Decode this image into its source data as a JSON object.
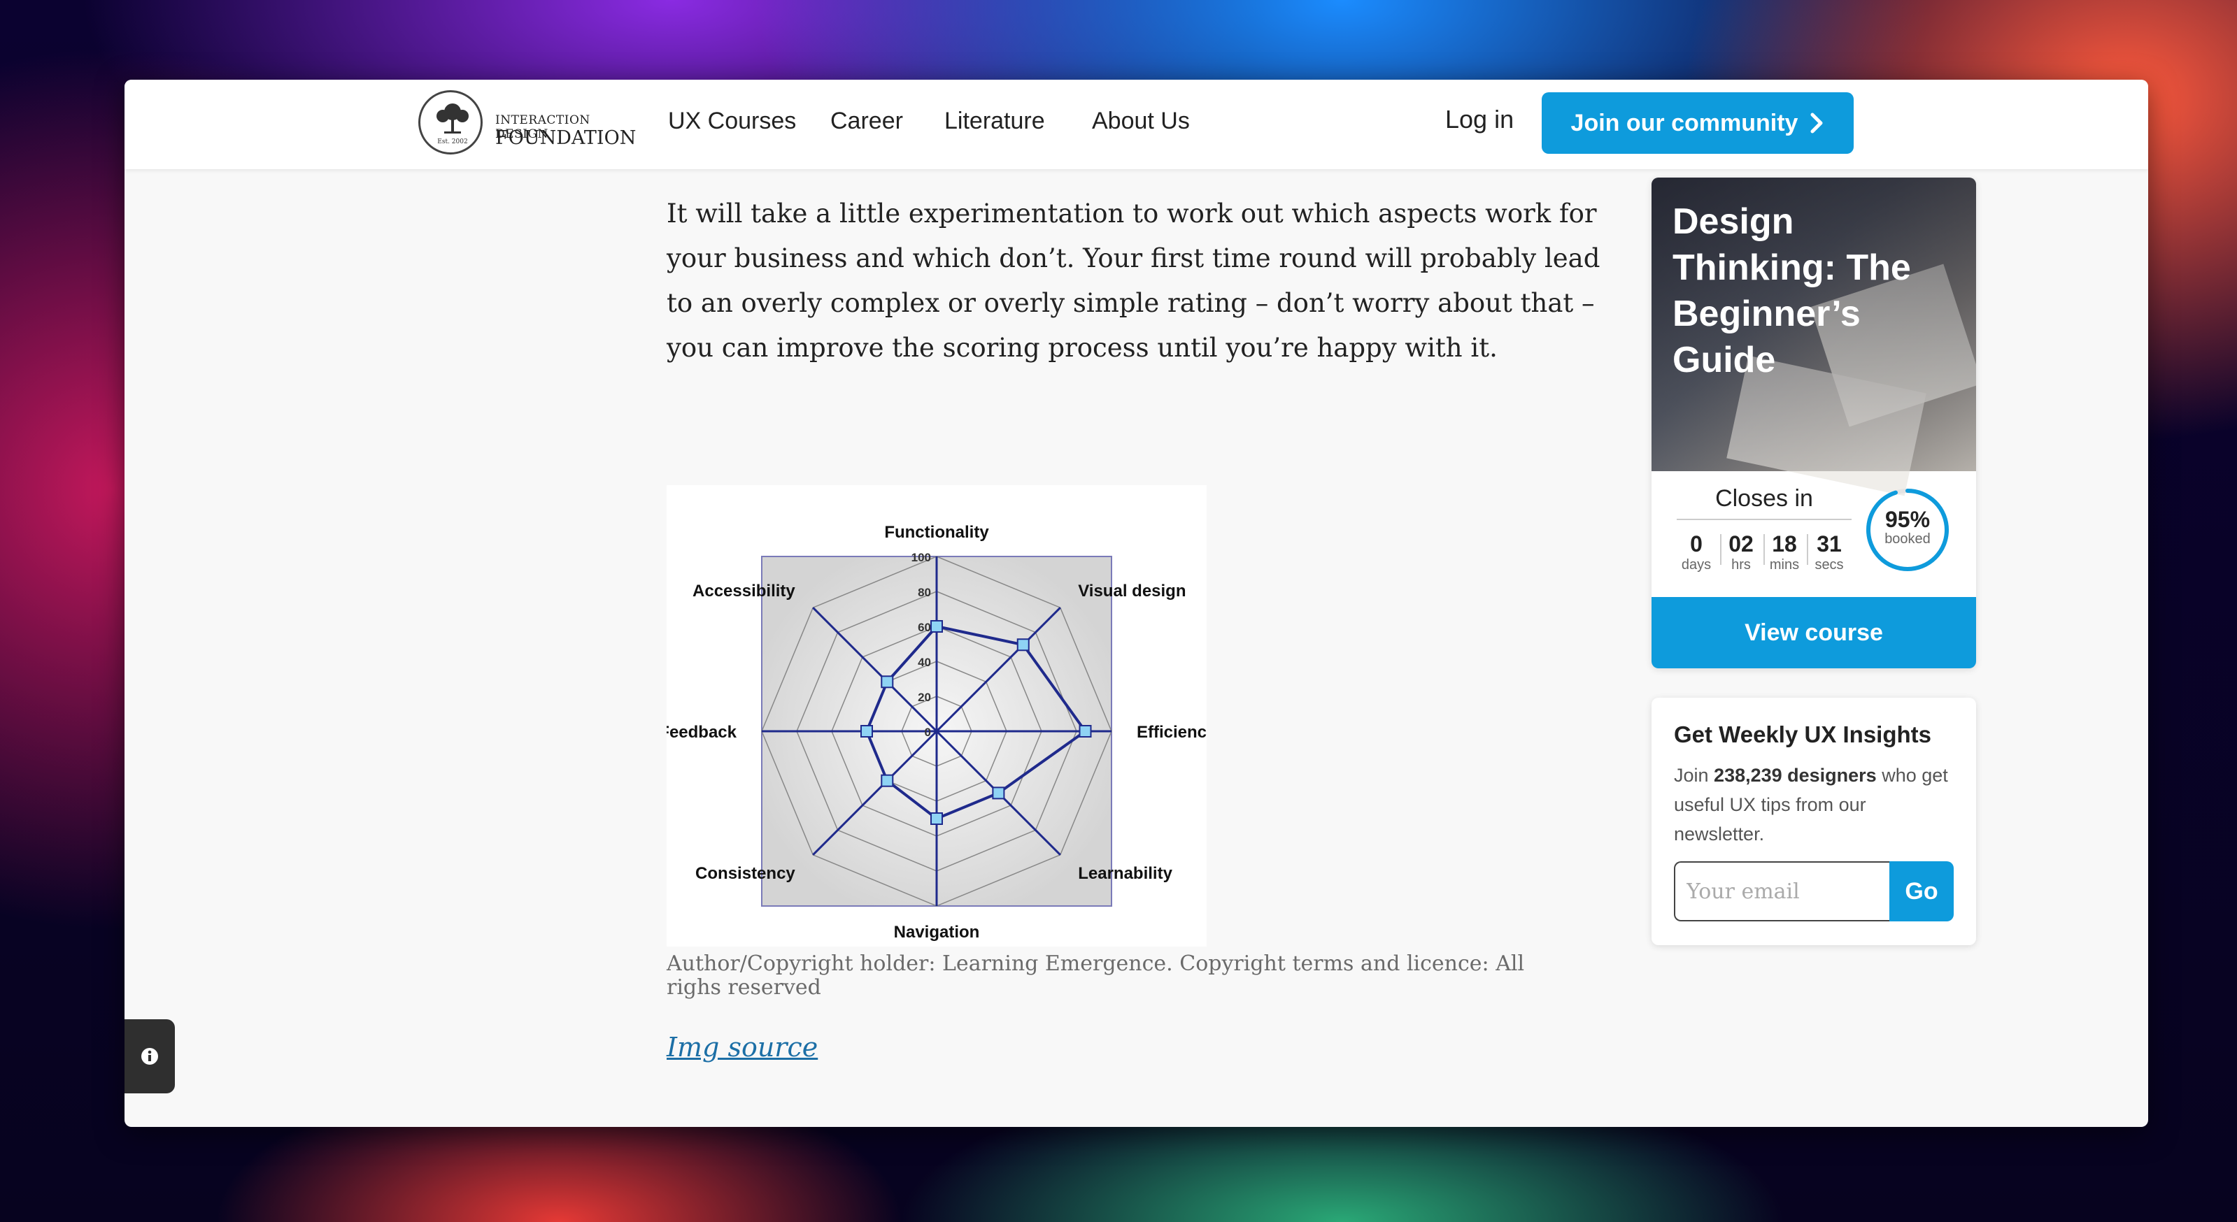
{
  "brand": {
    "logo_line1": "INTERACTION DESIGN",
    "logo_line2": "FOUNDATION",
    "logo_est": "Est. 2002"
  },
  "nav": {
    "links": [
      "UX Courses",
      "Career",
      "Literature",
      "About Us"
    ],
    "login_label": "Log in",
    "cta_label": "Join our community"
  },
  "article": {
    "paragraph": "It will take a little experimentation to work out which aspects work for your business and which don’t. Your first time round will probably lead to an overly complex or overly simple rating – don’t worry about that – you can improve the scoring process until you’re happy with it.",
    "caption": "Author/Copyright holder: Learning Emergence. Copyright terms and licence: All righs reserved",
    "img_source_label": "Img source"
  },
  "chart_data": {
    "type": "radar",
    "categories": [
      "Functionality",
      "Visual design",
      "Efficiency",
      "Learnability",
      "Navigation",
      "Consistency",
      "Feedback",
      "Accessibility"
    ],
    "values": [
      60,
      70,
      85,
      50,
      50,
      40,
      40,
      40
    ],
    "rlim": [
      0,
      100
    ],
    "ticks": [
      0,
      20,
      40,
      60,
      80,
      100
    ],
    "grid": true,
    "colors": {
      "line": "#1f2a8c",
      "marker": "#8fd3f4"
    }
  },
  "course": {
    "title": "Design Thinking: The Beginner’s Guide",
    "closes_label": "Closes in",
    "countdown": [
      {
        "value": "0",
        "unit": "days"
      },
      {
        "value": "02",
        "unit": "hrs"
      },
      {
        "value": "18",
        "unit": "mins"
      },
      {
        "value": "31",
        "unit": "secs"
      }
    ],
    "booked_percent": "95%",
    "booked_fraction": 0.95,
    "booked_label": "booked",
    "view_label": "View course"
  },
  "newsletter": {
    "title": "Get Weekly UX Insights",
    "body_prefix": "Join ",
    "body_count": "238,239 designers",
    "body_suffix": " who get useful UX tips from our newsletter.",
    "email_placeholder": "Your email",
    "go_label": "Go"
  },
  "colors": {
    "accent": "#0e9bdc"
  },
  "icons": {
    "info": "info-icon",
    "chevron": "chevron-right-icon"
  }
}
